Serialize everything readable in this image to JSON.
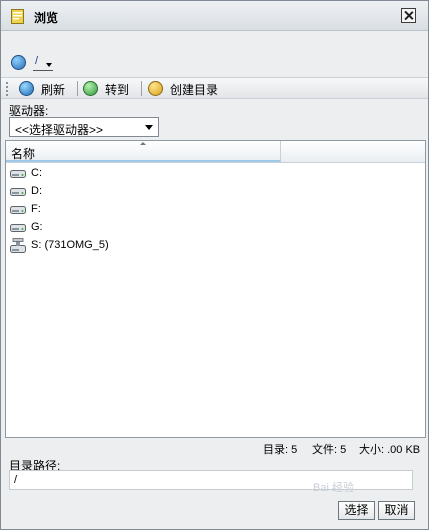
{
  "window": {
    "title": "浏览"
  },
  "path_bar": {
    "current_path": "/"
  },
  "toolbar": {
    "refresh": "刷新",
    "goto": "转到",
    "create_dir": "创建目录"
  },
  "drive": {
    "label": "驱动器:",
    "selected": "<<选择驱动器>>"
  },
  "list": {
    "column_name": "名称",
    "items": [
      {
        "label": "C:",
        "icon": "hard-drive-icon"
      },
      {
        "label": "D:",
        "icon": "hard-drive-icon"
      },
      {
        "label": "F:",
        "icon": "hard-drive-icon"
      },
      {
        "label": "G:",
        "icon": "hard-drive-icon"
      },
      {
        "label": "S: (731OMG_5)",
        "icon": "network-drive-icon"
      }
    ]
  },
  "status": {
    "dirs_label": "目录: 5",
    "files_label": "文件: 5",
    "size_label": "大小: .00 KB"
  },
  "path_field": {
    "label": "目录路径:",
    "value": "/"
  },
  "buttons": {
    "select": "选择",
    "cancel": "取消"
  },
  "watermark": "Bai 经验"
}
